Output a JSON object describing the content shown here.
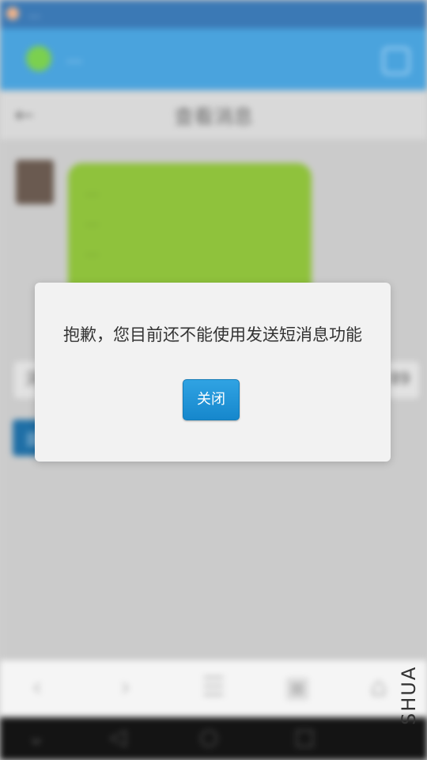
{
  "status_bar": {
    "text": "…"
  },
  "browser": {
    "url_text": "…"
  },
  "page": {
    "title": "查看消息",
    "back_icon": "back-arrow-icon"
  },
  "message": {
    "lines": [
      "…",
      "…",
      "…"
    ]
  },
  "input": {
    "left_text": "河",
    "right_text": "89"
  },
  "reply_button": {
    "label": "回"
  },
  "bottom_nav": {
    "icons": [
      "back-icon",
      "forward-icon",
      "menu-icon",
      "tabs-icon",
      "home-icon"
    ]
  },
  "system_nav": {
    "icons": [
      "down-icon",
      "back-icon",
      "home-icon",
      "recent-apps-icon"
    ]
  },
  "dialog": {
    "message": "抱歉，您目前还不能使用发送短消息功能",
    "close_label": "关闭"
  },
  "watermark": "SHUA"
}
